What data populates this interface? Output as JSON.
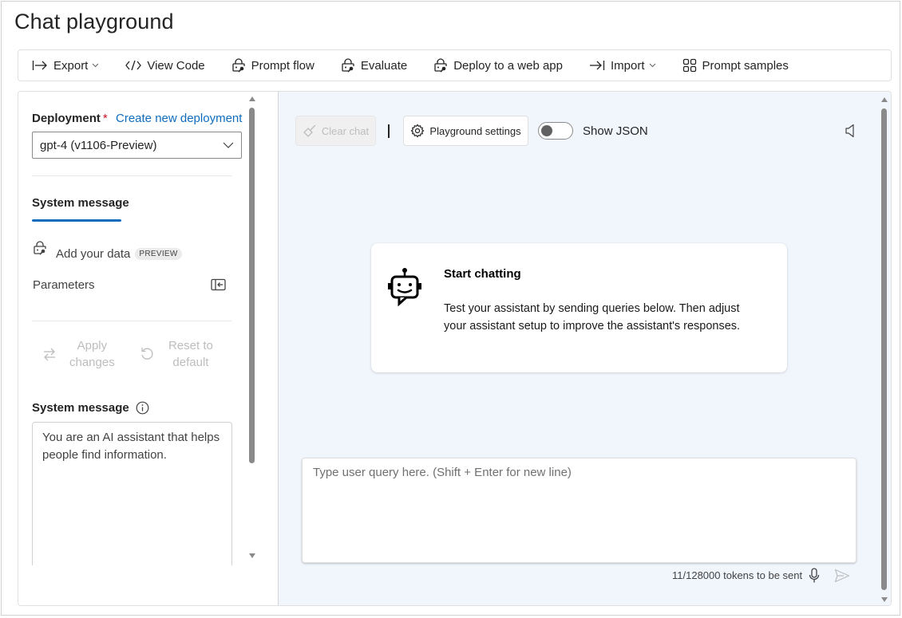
{
  "page": {
    "title": "Chat playground"
  },
  "toolbar": {
    "items": [
      {
        "label": "Export",
        "icon": "export-icon",
        "has_dropdown": true
      },
      {
        "label": "View Code",
        "icon": "code-icon",
        "has_dropdown": false
      },
      {
        "label": "Prompt flow",
        "icon": "lock-key-icon",
        "has_dropdown": false
      },
      {
        "label": "Evaluate",
        "icon": "lock-key-icon",
        "has_dropdown": false
      },
      {
        "label": "Deploy to a web app",
        "icon": "lock-key-icon",
        "has_dropdown": false
      },
      {
        "label": "Import",
        "icon": "import-icon",
        "has_dropdown": true
      },
      {
        "label": "Prompt samples",
        "icon": "grid-icon",
        "has_dropdown": false
      }
    ]
  },
  "setup": {
    "deployment_label": "Deployment",
    "required_marker": "*",
    "create_link": "Create new deployment",
    "deployment_value": "gpt-4 (v1106-Preview)",
    "active_tab": "System message",
    "add_data_label": "Add your data",
    "preview_badge": "PREVIEW",
    "parameters_label": "Parameters",
    "apply_changes_line1": "Apply",
    "apply_changes_line2": "changes",
    "reset_line1": "Reset to",
    "reset_line2": "default",
    "system_message_label": "System message",
    "system_message_value": "You are an AI assistant that helps people find information."
  },
  "chat": {
    "clear_chat_label": "Clear chat",
    "playground_settings_label": "Playground settings",
    "show_json_label": "Show JSON",
    "show_json_on": false,
    "card_title": "Start chatting",
    "card_text": "Test your assistant by sending queries below. Then adjust your assistant setup to improve the assistant's responses.",
    "query_placeholder": "Type user query here. (Shift + Enter for new line)",
    "token_count": "11/128000 tokens to be sent"
  },
  "colors": {
    "accent": "#0f6cbd",
    "required": "#c50f1f",
    "chat_background": "#f1f6fd",
    "disabled_text": "#bdbdbd"
  }
}
